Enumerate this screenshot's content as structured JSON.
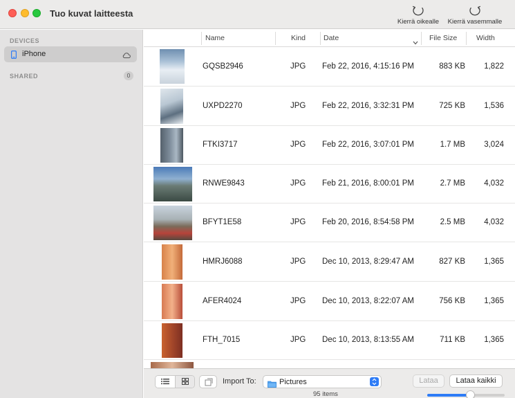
{
  "window": {
    "title": "Tuo kuvat laitteesta"
  },
  "toolbar": {
    "rotate_right_label": "Kierrä oikealle",
    "rotate_left_label": "Kierrä vasemmalle"
  },
  "sidebar": {
    "devices_heading": "DEVICES",
    "device": {
      "label": "iPhone"
    },
    "shared_heading": "SHARED",
    "shared_count": "0"
  },
  "table": {
    "columns": {
      "name": "Name",
      "kind": "Kind",
      "date": "Date",
      "file_size": "File Size",
      "width": "Width"
    },
    "rows": [
      {
        "name": "GQSB2946",
        "kind": "JPG",
        "date": "Feb 22, 2016, 4:15:16 PM",
        "size": "883 KB",
        "width": "1,822"
      },
      {
        "name": "UXPD2270",
        "kind": "JPG",
        "date": "Feb 22, 2016, 3:32:31 PM",
        "size": "725 KB",
        "width": "1,536"
      },
      {
        "name": "FTKI3717",
        "kind": "JPG",
        "date": "Feb 22, 2016, 3:07:01 PM",
        "size": "1.7 MB",
        "width": "3,024"
      },
      {
        "name": "RNWE9843",
        "kind": "JPG",
        "date": "Feb 21, 2016, 8:00:01 PM",
        "size": "2.7 MB",
        "width": "4,032"
      },
      {
        "name": "BFYT1E58",
        "kind": "JPG",
        "date": "Feb 20, 2016, 8:54:58 PM",
        "size": "2.5 MB",
        "width": "4,032"
      },
      {
        "name": "HMRJ6088",
        "kind": "JPG",
        "date": "Dec 10, 2013, 8:29:47 AM",
        "size": "827 KB",
        "width": "1,365"
      },
      {
        "name": "AFER4024",
        "kind": "JPG",
        "date": "Dec 10, 2013, 8:22:07 AM",
        "size": "756 KB",
        "width": "1,365"
      },
      {
        "name": "FTH_7015",
        "kind": "JPG",
        "date": "Dec 10, 2013, 8:13:55 AM",
        "size": "711 KB",
        "width": "1,365"
      }
    ]
  },
  "bottom": {
    "import_to_label": "Import To:",
    "destination": "Pictures",
    "items_count": "95 items",
    "download_label": "Lataa",
    "download_all_label": "Lataa kaikki",
    "thumbnail_size": 0.55
  },
  "colors": {
    "accent": "#2e7cf6",
    "sidebar_bg": "#e4e3e3",
    "selected_row": "#cecdcd"
  },
  "icons": {
    "rotate_right": "rotate-right-icon",
    "rotate_left": "rotate-left-icon",
    "device": "iphone-icon",
    "eject": "cloud-icon",
    "list_view": "list-view-icon",
    "grid_view": "grid-view-icon",
    "folder": "folder-icon"
  }
}
